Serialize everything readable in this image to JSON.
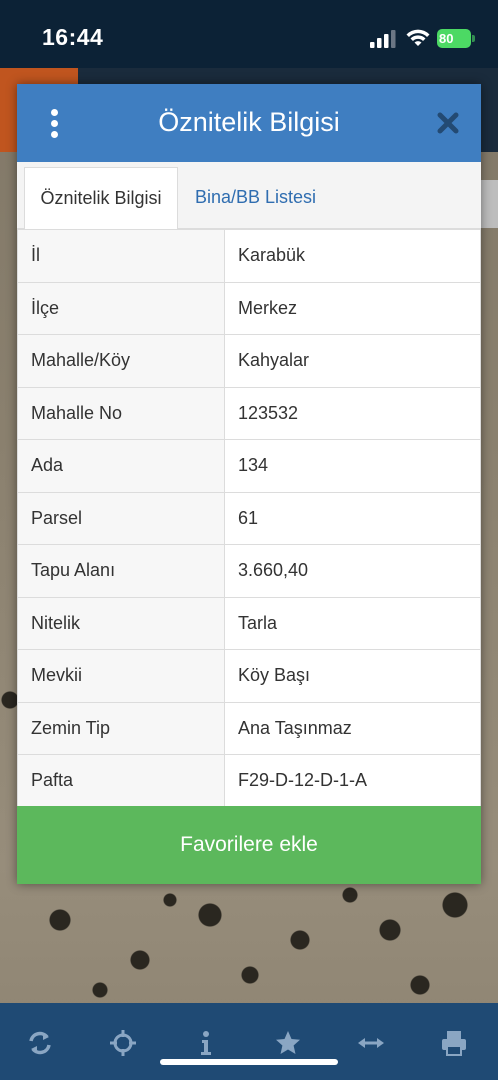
{
  "status_bar": {
    "time": "16:44",
    "battery": "80"
  },
  "dialog": {
    "title": "Öznitelik Bilgisi",
    "tabs": [
      {
        "label": "Öznitelik Bilgisi",
        "active": true
      },
      {
        "label": "Bina/BB Listesi",
        "active": false
      }
    ],
    "rows": [
      {
        "key": "İl",
        "value": "Karabük"
      },
      {
        "key": "İlçe",
        "value": "Merkez"
      },
      {
        "key": "Mahalle/Köy",
        "value": "Kahyalar"
      },
      {
        "key": "Mahalle No",
        "value": "123532"
      },
      {
        "key": "Ada",
        "value": "134"
      },
      {
        "key": "Parsel",
        "value": "61"
      },
      {
        "key": "Tapu Alanı",
        "value": "3.660,40"
      },
      {
        "key": "Nitelik",
        "value": "Tarla"
      },
      {
        "key": "Mevkii",
        "value": "Köy Başı"
      },
      {
        "key": "Zemin Tip",
        "value": "Ana Taşınmaz"
      },
      {
        "key": "Pafta",
        "value": "F29-D-12-D-1-A"
      }
    ],
    "favorite_button": "Favorilere ekle"
  },
  "bottom_bar": {
    "icons": [
      "refresh-icon",
      "crosshair-icon",
      "info-icon",
      "star-icon",
      "measure-icon",
      "print-icon"
    ]
  },
  "colors": {
    "header": "#3f7ec1",
    "favorite": "#5cb85c",
    "bottom_bar": "#1f4a74",
    "status_bar": "#0c2236",
    "link": "#2f6db0"
  }
}
